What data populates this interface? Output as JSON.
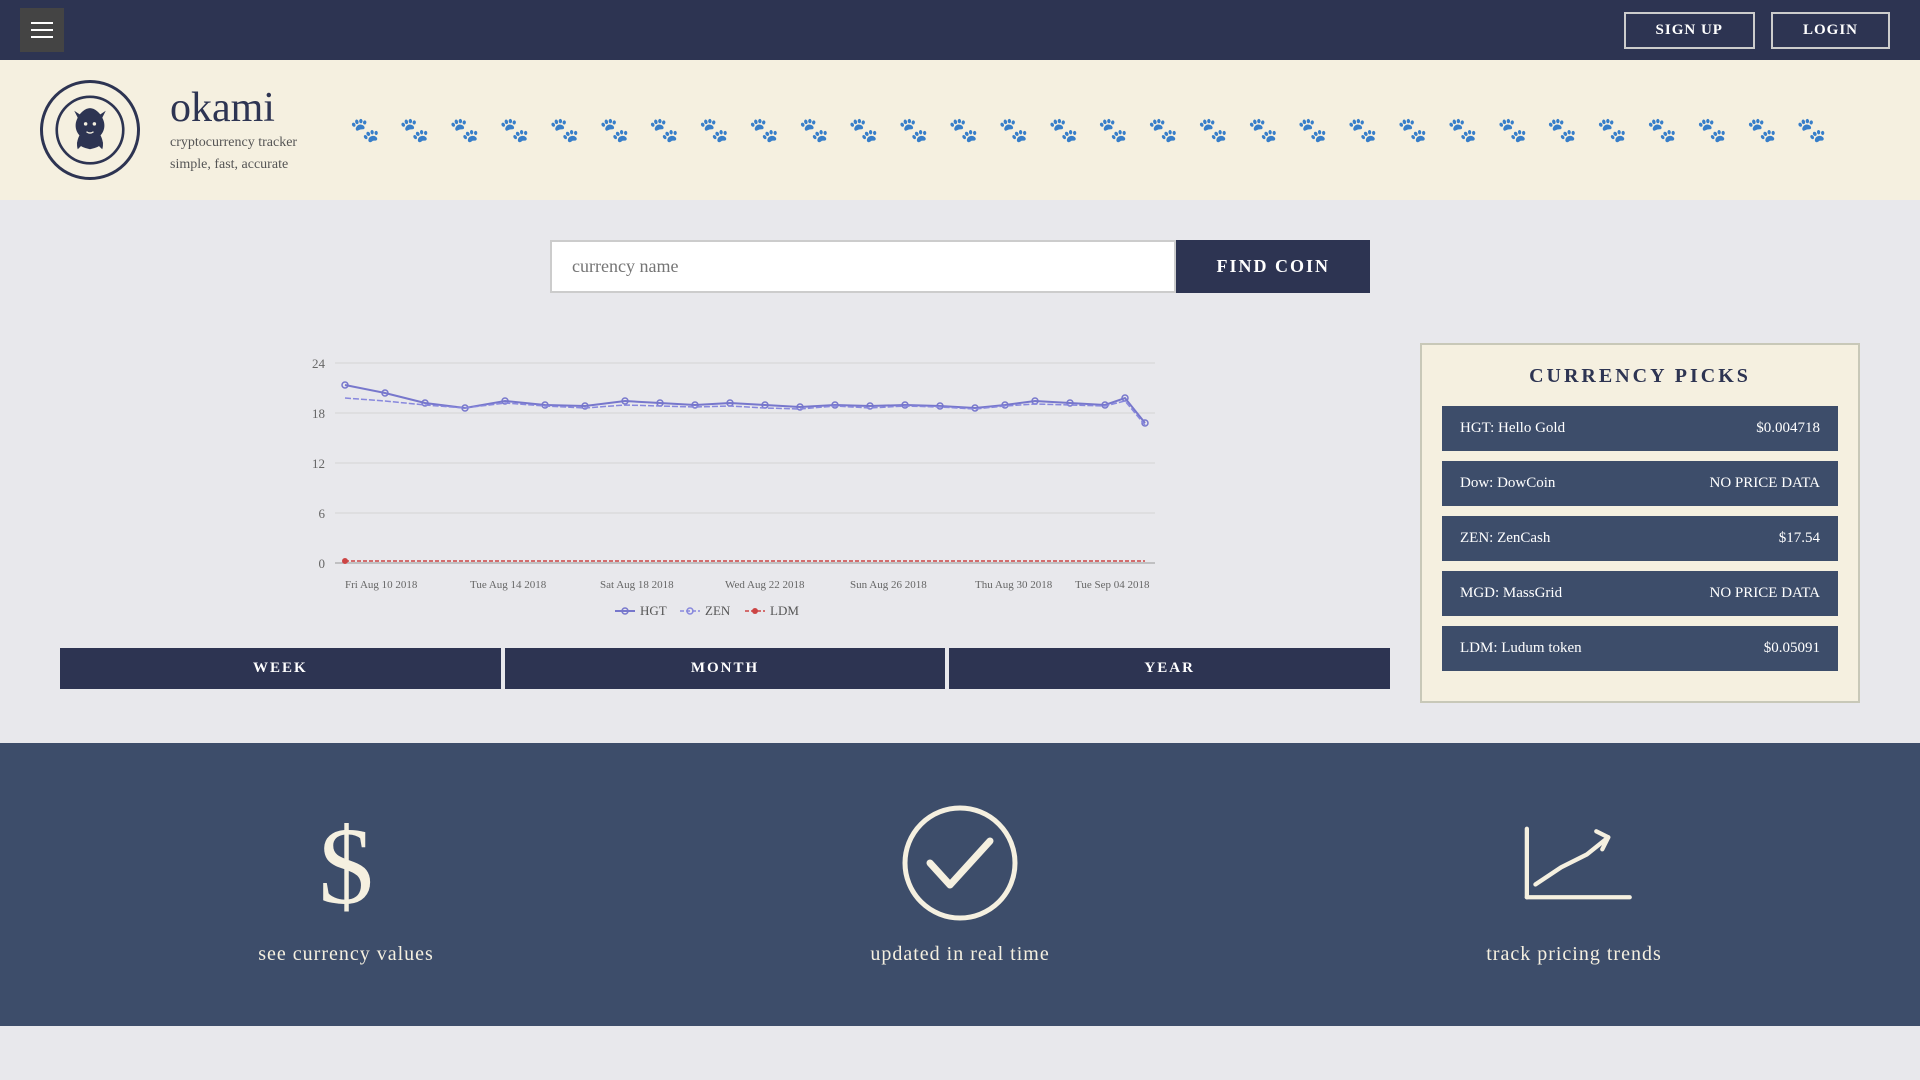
{
  "navbar": {
    "signup_label": "SIGN UP",
    "login_label": "LOGIN",
    "hamburger_label": "menu"
  },
  "header": {
    "brand_name": "okami",
    "tagline1": "cryptocurrency tracker",
    "tagline2": "simple, fast, accurate"
  },
  "search": {
    "placeholder": "currency name",
    "find_button": "FIND COIN"
  },
  "chart": {
    "y_labels": [
      "0",
      "6",
      "12",
      "18",
      "24"
    ],
    "x_labels": [
      "Fri Aug 10 2018",
      "Tue Aug 14 2018",
      "Sat Aug 18 2018",
      "Wed Aug 22 2018",
      "Sun Aug 26 2018",
      "Thu Aug 30 2018",
      "Tue Sep 04 2018"
    ],
    "legend": [
      {
        "name": "HGT",
        "color": "#6666cc"
      },
      {
        "name": "ZEN",
        "color": "#6666cc"
      },
      {
        "name": "LDM",
        "color": "#cc3333"
      }
    ],
    "time_buttons": [
      "WEEK",
      "MONTH",
      "YEAR"
    ]
  },
  "currency_picks": {
    "title": "CURRENCY PICKS",
    "items": [
      {
        "name": "HGT: Hello Gold",
        "price": "$0.004718"
      },
      {
        "name": "Dow: DowCoin",
        "price": "NO PRICE DATA"
      },
      {
        "name": "ZEN: ZenCash",
        "price": "$17.54"
      },
      {
        "name": "MGD: MassGrid",
        "price": "NO PRICE DATA"
      },
      {
        "name": "LDM: Ludum token",
        "price": "$0.05091"
      }
    ]
  },
  "footer": {
    "items": [
      {
        "label": "see currency values",
        "icon": "dollar-icon"
      },
      {
        "label": "updated in real time",
        "icon": "checkmark-icon"
      },
      {
        "label": "track pricing trends",
        "icon": "trend-icon"
      }
    ]
  }
}
